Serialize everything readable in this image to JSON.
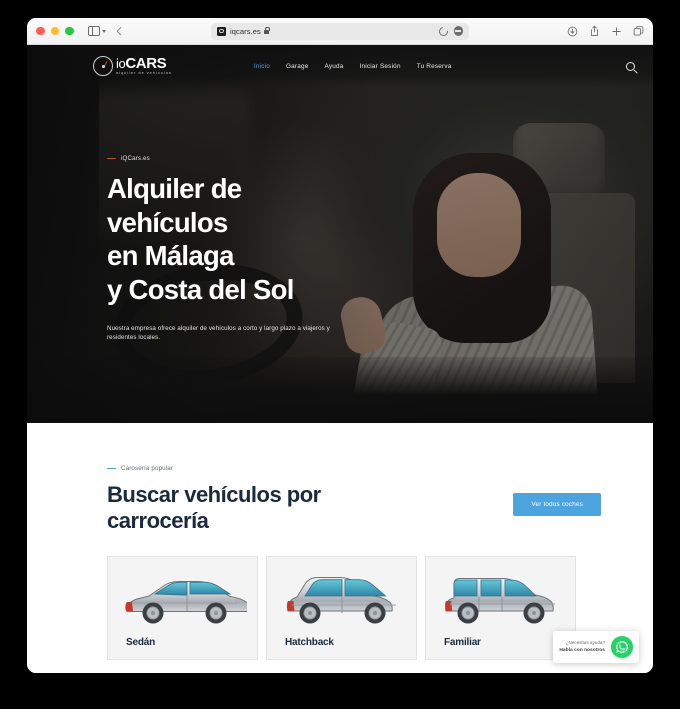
{
  "browser": {
    "url": "iqcars.es",
    "favicon_name": "iqcars-favicon",
    "traffic_lights": [
      "close",
      "minimize",
      "zoom"
    ],
    "toolbar_icons": {
      "sidebar": "sidebar-icon",
      "sidebar_chevron": "chevron-down-icon",
      "back": "back-chevron-icon",
      "reload": "reload-icon",
      "shield": "privacy-report-icon",
      "downloads": "downloads-icon",
      "share": "share-icon",
      "new_tab": "new-tab-icon",
      "tab_overview": "tab-overview-icon"
    }
  },
  "site": {
    "logo": {
      "prefix": "io",
      "main": "CARS",
      "tagline": "alquiler de vehículos"
    },
    "nav": [
      {
        "label": "Inicio",
        "active": true
      },
      {
        "label": "Garage",
        "active": false
      },
      {
        "label": "Ayuda",
        "active": false
      },
      {
        "label": "Iniciar Sesión",
        "active": false
      },
      {
        "label": "Tu Reserva",
        "active": false
      }
    ],
    "search_icon": "search-icon"
  },
  "hero": {
    "eyebrow": "iQCars.es",
    "eyebrow_dash_color": "#d0402c",
    "title_line1": "Alquiler de vehículos",
    "title_line2": "en Málaga",
    "title_line3": "y Costa del Sol",
    "subtitle": "Nuestra empresa ofrece alquiler de vehículos a corto y largo plazo a viajeros y residentes locales."
  },
  "bodytype_section": {
    "eyebrow": "Carosería popular",
    "eyebrow_dash_color": "#4da3dd",
    "title_line1": "Buscar vehículos por",
    "title_line2": "carrocería",
    "cta_label": "Ver todos coches",
    "cta_color": "#4da3dd",
    "cards": [
      {
        "label": "Sedán",
        "icon": "sedan-car-icon"
      },
      {
        "label": "Hatchback",
        "icon": "hatchback-car-icon"
      },
      {
        "label": "Familiar",
        "icon": "estate-car-icon"
      }
    ]
  },
  "whatsapp_widget": {
    "line1": "¿Necesitas ayuda?",
    "line2": "Habla con nosotros",
    "icon": "whatsapp-icon",
    "color": "#25d366"
  }
}
